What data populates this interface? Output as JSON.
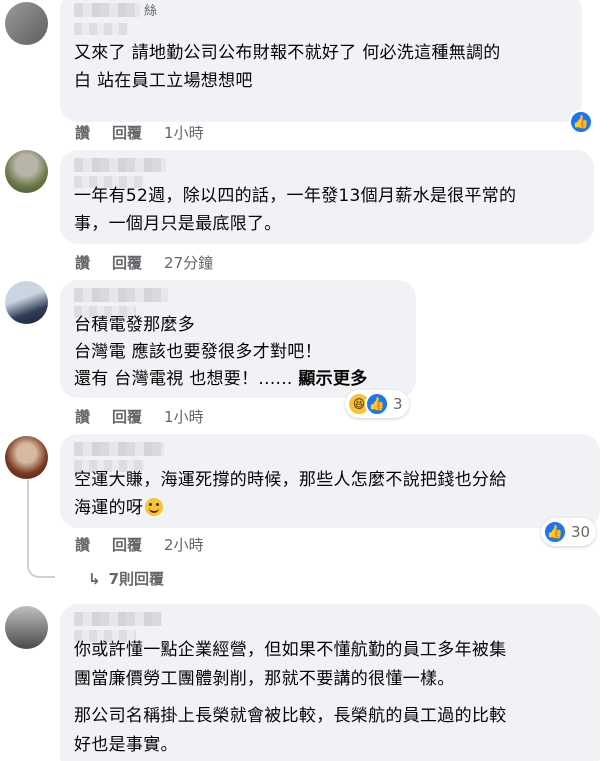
{
  "comments": [
    {
      "text": "又來了 請地勤公司公布財報不就好了 何必洗這種無調的\n白 站在員工立場想想吧",
      "more": "",
      "name_fragment": "絲",
      "like_label": "讚",
      "reply_label": "回覆",
      "time": "1小時",
      "reaction_count": ""
    },
    {
      "text": "一年有52週，除以四的話，一年發13個月薪水是很平常的\n事，一個月只是最底限了。",
      "more": "",
      "like_label": "讚",
      "reply_label": "回覆",
      "time": "27分鐘",
      "reaction_count": ""
    },
    {
      "text": "台積電發那麼多\n台灣電 應該也要發很多才對吧！\n還有 台灣電視 也想要！...... ",
      "more": "顯示更多",
      "like_label": "讚",
      "reply_label": "回覆",
      "time": "1小時",
      "reaction_count": "3"
    },
    {
      "text": "空運大賺，海運死撐的時候，那些人怎麼不說把錢也分給\n海運的呀",
      "more": "",
      "like_label": "讚",
      "reply_label": "回覆",
      "time": "2小時",
      "reaction_count": "30",
      "replies_label": "7則回覆"
    },
    {
      "text": "你或許懂一點企業經營，但如果不懂航勤的員工多年被集\n團當廉價勞工團體剝削，那就不要講的很懂一樣。",
      "text2": "那公司名稱掛上長榮就會被比較，長榮航的員工過的比較\n好也是事實。",
      "more": ""
    }
  ],
  "colors": {
    "bubble": "#f0f2f5",
    "meta": "#65676b",
    "like": "#1877f2",
    "haha": "#f7c437"
  }
}
